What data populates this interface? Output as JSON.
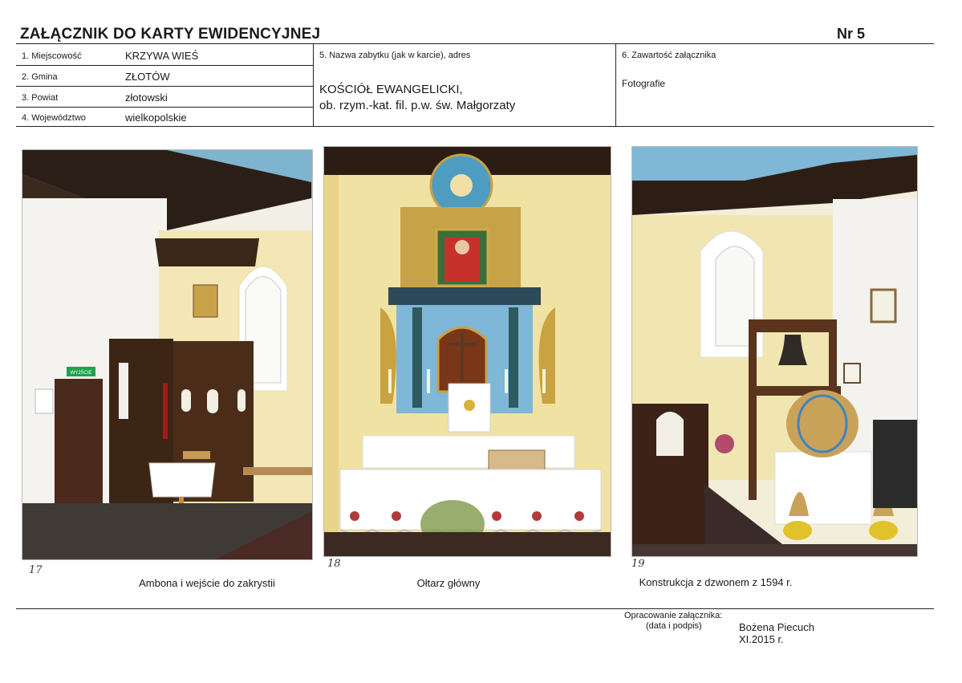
{
  "header": {
    "title": "ZAŁĄCZNIK DO KARTY EWIDENCYJNEJ",
    "number": "Nr 5"
  },
  "fields": {
    "f1": {
      "label": "1. Miejscowość",
      "value": "KRZYWA WIEŚ"
    },
    "f2": {
      "label": "2. Gmina",
      "value": "ZŁOTÓW"
    },
    "f3": {
      "label": "3. Powiat",
      "value": "złotowski"
    },
    "f4": {
      "label": "4. Województwo",
      "value": "wielkopolskie"
    },
    "f5": {
      "label": "5. Nazwa zabytku (jak w karcie), adres",
      "line1": "KOŚCIÓŁ EWANGELICKI,",
      "line2": "ob. rzym.-kat. fil. p.w. św. Małgorzaty"
    },
    "f6": {
      "label": "6. Zawartość załącznika",
      "value": "Fotografie"
    }
  },
  "photos": [
    {
      "number": "17",
      "caption": "Ambona i wejście do zakrystii",
      "sign": "WYJŚCIE"
    },
    {
      "number": "18",
      "caption": "Ołtarz główny"
    },
    {
      "number": "19",
      "caption": "Konstrukcja z dzwonem z 1594 r."
    }
  ],
  "footer": {
    "prepared_label": "Opracowanie załącznika:",
    "date_sign_label": "(data i podpis)",
    "author": "Bożena Piecuch",
    "date": "XI.2015 r."
  }
}
